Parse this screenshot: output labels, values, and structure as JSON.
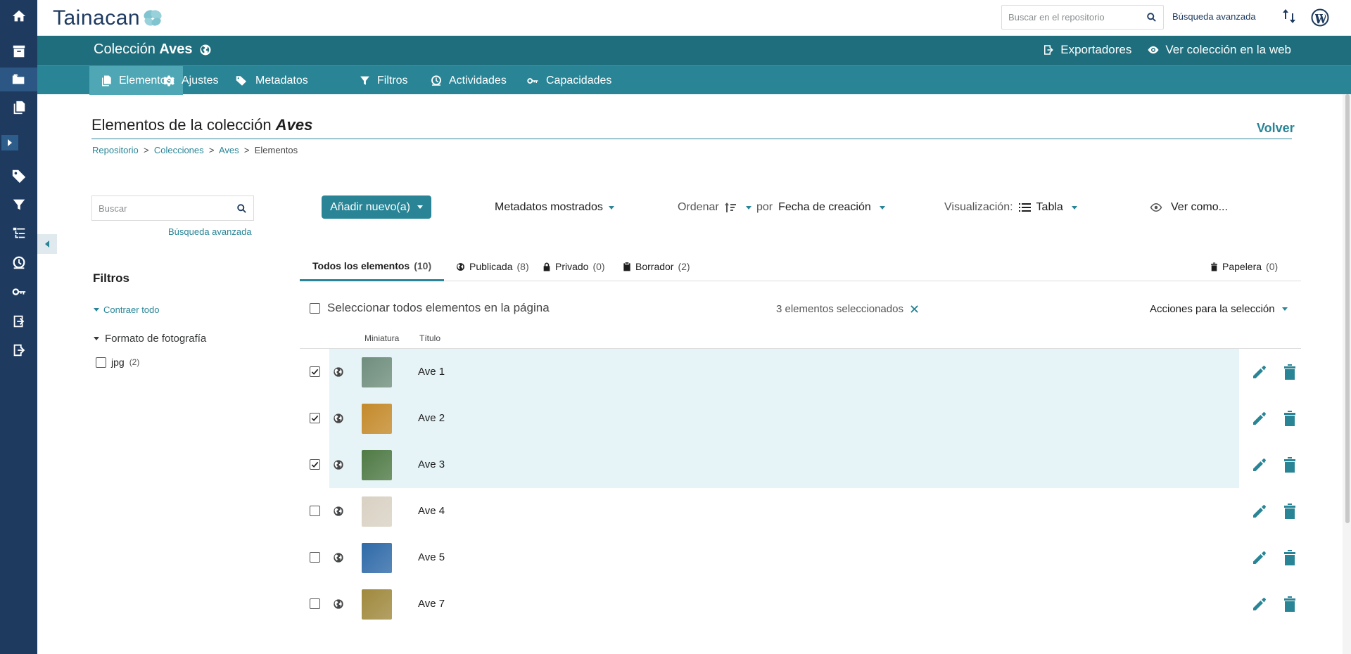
{
  "app": {
    "logo": "Tainacan"
  },
  "topbar": {
    "search_placeholder": "Buscar en el repositorio",
    "advanced_search": "Búsqueda avanzada"
  },
  "collection_bar": {
    "prefix": "Colección",
    "name": "Aves",
    "exporters": "Exportadores",
    "view_web": "Ver colección en la web"
  },
  "nav_tabs": [
    "Elementos",
    "Ajustes",
    "Metadatos",
    "Filtros",
    "Actividades",
    "Capacidades"
  ],
  "page": {
    "title_prefix": "Elementos de la colección",
    "title_name": "Aves",
    "back": "Volver",
    "breadcrumb": [
      "Repositorio",
      "Colecciones",
      "Aves",
      "Elementos"
    ],
    "breadcrumb_sep": ">"
  },
  "left": {
    "search_placeholder": "Buscar",
    "advanced_search": "Búsqueda avanzada",
    "filters_title": "Filtros",
    "collapse_all": "Contraer todo",
    "filter_group": "Formato de fotografía",
    "filter_option": "jpg",
    "filter_option_count": "(2)"
  },
  "toolbar": {
    "add_new": "Añadir nuevo(a)",
    "metadata_shown": "Metadatos mostrados",
    "sort_label": "Ordenar",
    "sort_by": "por",
    "sort_field": "Fecha de creación",
    "view_label": "Visualización:",
    "view_mode": "Tabla",
    "view_as": "Ver como..."
  },
  "status_tabs": [
    {
      "label": "Todos los elementos",
      "count": "(10)"
    },
    {
      "label": "Publicada",
      "count": "(8)"
    },
    {
      "label": "Privado",
      "count": "(0)"
    },
    {
      "label": "Borrador",
      "count": "(2)"
    },
    {
      "label": "Papelera",
      "count": "(0)"
    }
  ],
  "selection": {
    "select_all": "Seleccionar todos elementos en la página",
    "selected_count": "3 elementos seleccionados",
    "actions": "Acciones para la selección"
  },
  "table": {
    "headers": {
      "thumbnail": "Miniatura",
      "title": "Título"
    },
    "rows": [
      {
        "title": "Ave 1",
        "checked": true,
        "thumb_color": "#6f8e7d"
      },
      {
        "title": "Ave 2",
        "checked": true,
        "thumb_color": "#c48a2b"
      },
      {
        "title": "Ave 3",
        "checked": true,
        "thumb_color": "#4f7a45"
      },
      {
        "title": "Ave 4",
        "checked": false,
        "thumb_color": "#d9d1c3"
      },
      {
        "title": "Ave 5",
        "checked": false,
        "thumb_color": "#2f6aa8"
      },
      {
        "title": "Ave 7",
        "checked": false,
        "thumb_color": "#a0893e"
      }
    ]
  },
  "colors": {
    "sidebar": "#1e3a5f",
    "collection_bar": "#1f6e7d",
    "tab_bar": "#298596",
    "accent": "#298596",
    "selected_row": "#e6f4f7"
  }
}
